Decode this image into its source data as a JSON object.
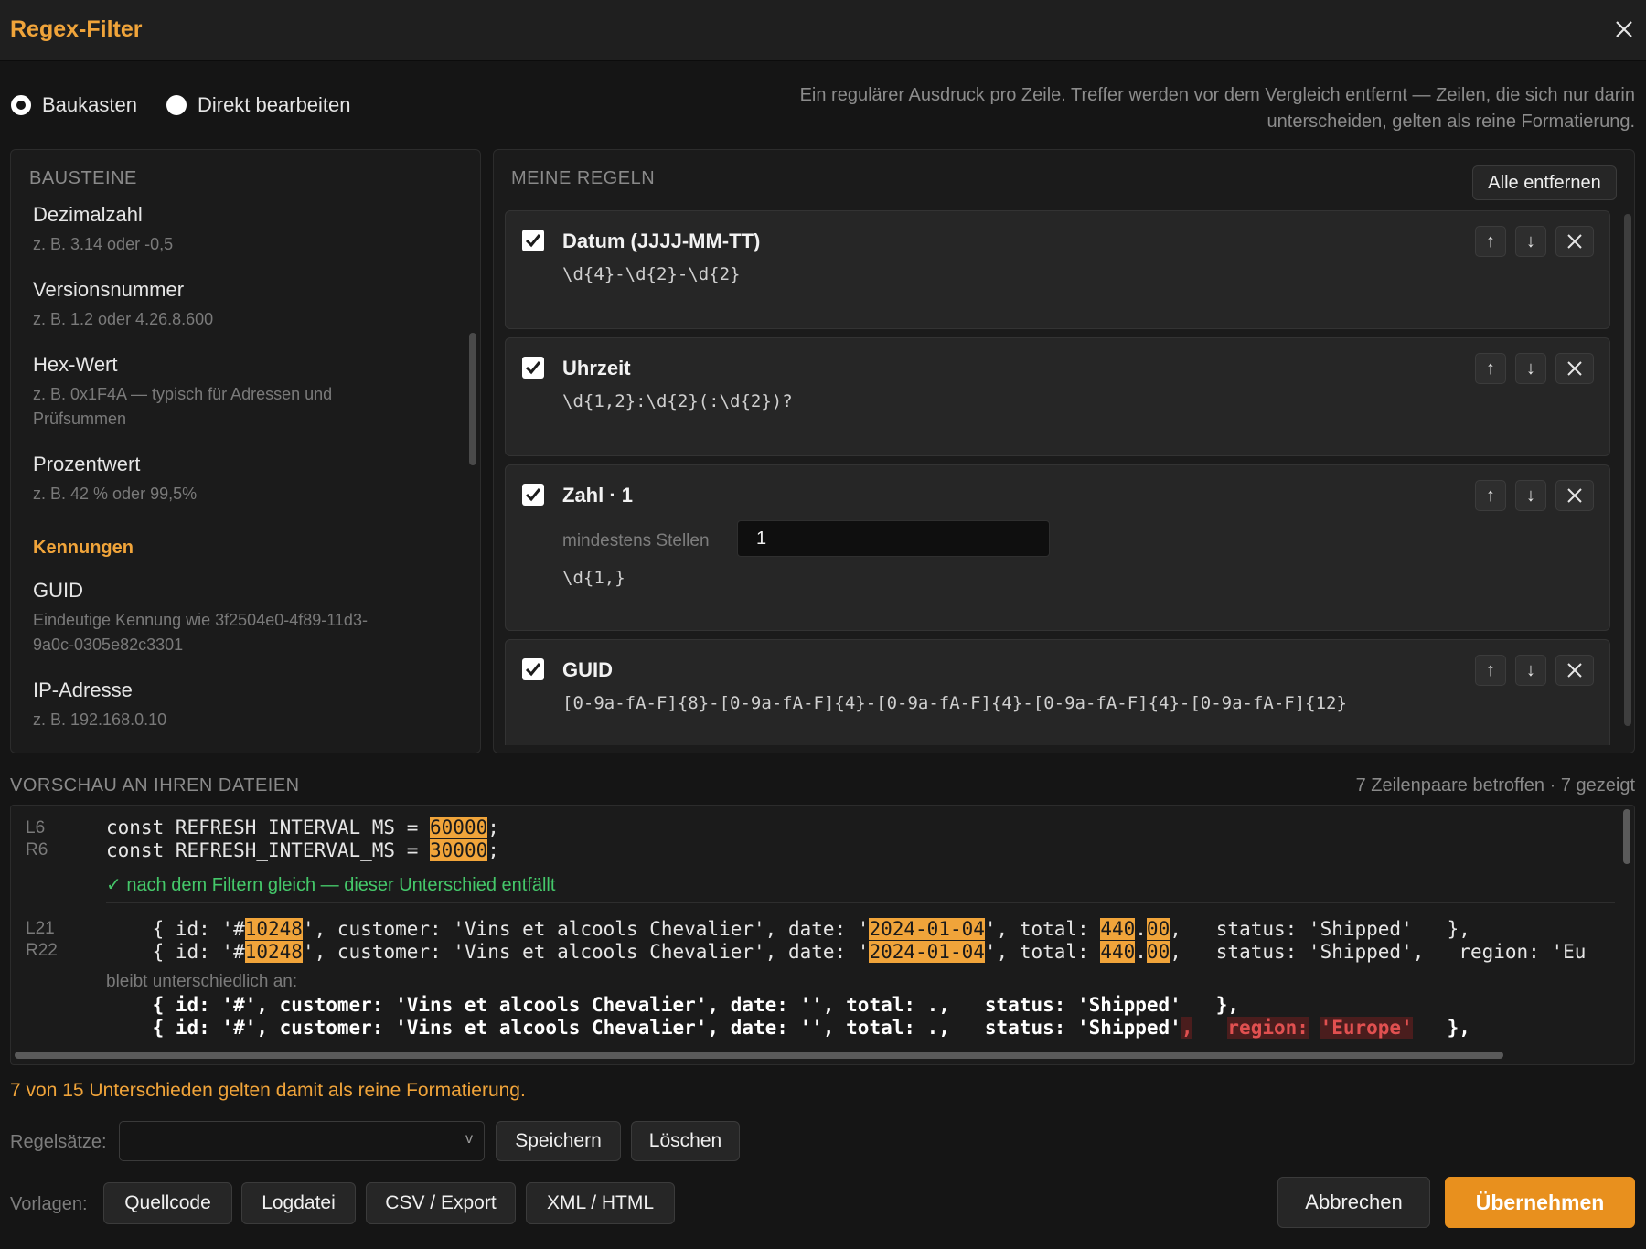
{
  "window": {
    "title": "Regex-Filter"
  },
  "mode": {
    "options": [
      "Baukasten",
      "Direkt bearbeiten"
    ],
    "selected": "Baukasten",
    "hint": "Ein regulärer Ausdruck pro Zeile. Treffer werden vor dem Vergleich entfernt — Zeilen, die sich nur darin unterscheiden, gelten als reine Formatierung."
  },
  "bausteine": {
    "title": "BAUSTEINE",
    "items": [
      {
        "name": "Dezimalzahl",
        "desc": "z. B. 3.14 oder -0,5"
      },
      {
        "name": "Versionsnummer",
        "desc": "z. B. 1.2 oder 4.26.8.600"
      },
      {
        "name": "Hex-Wert",
        "desc": "z. B. 0x1F4A — typisch für Adressen und Prüfsummen"
      },
      {
        "name": "Prozentwert",
        "desc": "z. B. 42 % oder 99,5%"
      }
    ],
    "category": "Kennungen",
    "items2": [
      {
        "name": "GUID",
        "desc": "Eindeutige Kennung wie 3f2504e0-4f89-11d3-9a0c-0305e82c3301"
      },
      {
        "name": "IP-Adresse",
        "desc": "z. B. 192.168.0.10"
      }
    ]
  },
  "rules": {
    "title": "MEINE REGELN",
    "remove_all": "Alle entfernen",
    "items": [
      {
        "name": "Datum (JJJJ-MM-TT)",
        "expr": "\\d{4}-\\d{2}-\\d{2}"
      },
      {
        "name": "Uhrzeit",
        "expr": "\\d{1,2}:\\d{2}(:\\d{2})?"
      },
      {
        "name": "Zahl · 1",
        "param_label": "mindestens Stellen",
        "param_value": "1",
        "expr": "\\d{1,}"
      },
      {
        "name": "GUID",
        "expr": "[0-9a-fA-F]{8}-[0-9a-fA-F]{4}-[0-9a-fA-F]{4}-[0-9a-fA-F]{4}-[0-9a-fA-F]{12}"
      }
    ],
    "ctrl_up": "↑",
    "ctrl_down": "↓"
  },
  "preview": {
    "title": "VORSCHAU AN IHREN DATEIEN",
    "stats": "7 Zeilenpaare betroffen · 7 gezeigt",
    "pair1": {
      "left_no": "L6",
      "right_no": "R6",
      "left_pre": "const REFRESH_INTERVAL_MS = ",
      "left_hl": "60000",
      "left_post": ";",
      "right_pre": "const REFRESH_INTERVAL_MS = ",
      "right_hl": "30000",
      "right_post": ";",
      "note": "✓ nach dem Filtern gleich — dieser Unterschied entfällt"
    },
    "pair2": {
      "left_no": "L21",
      "right_no": "R22",
      "p1": "    { id: '#",
      "id": "10248",
      "p2": "', customer: 'Vins et alcools Chevalier', date: '",
      "date": "2024-01-04",
      "p3": "', total: ",
      "t1": "440",
      "p4": ".",
      "t2": "00",
      "p5": ",   status: 'Shipped'   },",
      "p5r": ",   status: 'Shipped',   region: 'Eu",
      "remain_label": "bleibt unterschiedlich an:",
      "remain_left": "    { id: '#', customer: 'Vins et alcools Chevalier', date: '', total: .,   status: 'Shipped'   },",
      "remain_right_pre": "    { id: '#', customer: 'Vins et alcools Chevalier', date: '', total: .,   status: 'Shipped'",
      "remain_right_del1": ",",
      "remain_right_gap": "   ",
      "remain_right_del2": "region:",
      "remain_right_gap2": " ",
      "remain_right_del3": "'Europe'",
      "remain_right_post": "   },"
    }
  },
  "summary": "7 von 15 Unterschieden gelten damit als reine Formatierung.",
  "footer": {
    "rulesets_label": "Regelsätze:",
    "rulesets_value": "",
    "save": "Speichern",
    "delete": "Löschen",
    "templates_label": "Vorlagen:",
    "templates": [
      "Quellcode",
      "Logdatei",
      "CSV / Export",
      "XML / HTML"
    ],
    "cancel": "Abbrechen",
    "apply": "Übernehmen"
  },
  "colors": {
    "accent": "#f0a43a",
    "ok": "#45c86a",
    "removed": "#e05050"
  }
}
